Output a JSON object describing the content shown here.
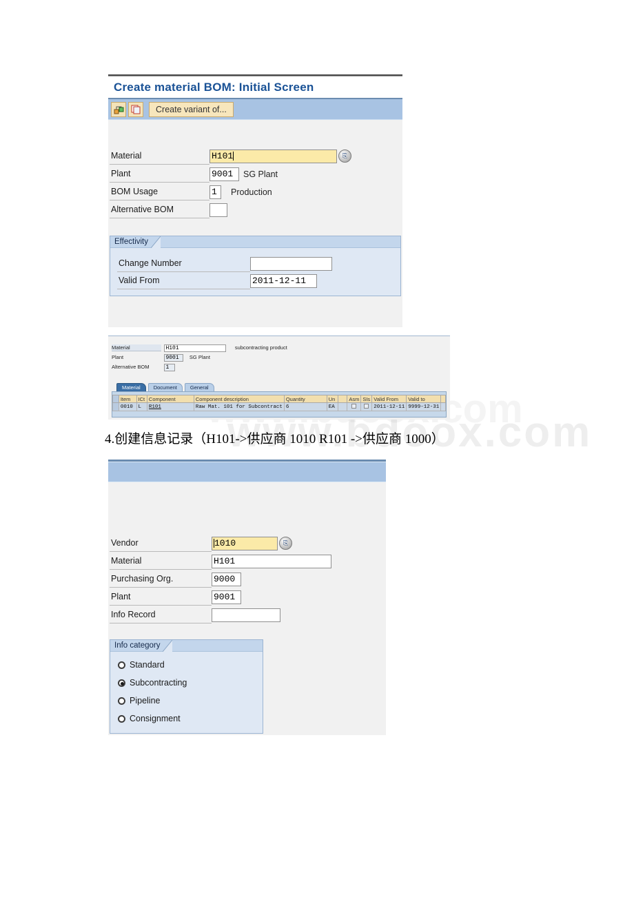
{
  "bom_screen": {
    "title": "Create material BOM: Initial Screen",
    "toolbar": {
      "icon1": "bom-copy-icon",
      "icon2": "copy-window-icon",
      "create_variant_label": "Create variant of..."
    },
    "fields": [
      {
        "label": "Material",
        "value": "H101",
        "desc": "",
        "focused": true
      },
      {
        "label": "Plant",
        "value": "9001",
        "desc": "SG Plant",
        "focused": false
      },
      {
        "label": "BOM Usage",
        "value": "1",
        "desc": "Production",
        "focused": false
      },
      {
        "label": "Alternative BOM",
        "value": "",
        "desc": "",
        "focused": false
      }
    ],
    "effectivity": {
      "legend": "Effectivity",
      "rows": [
        {
          "label": "Change Number",
          "value": ""
        },
        {
          "label": "Valid From",
          "value": "2011-12-11"
        }
      ]
    }
  },
  "bom_items_screen": {
    "header_fields": [
      {
        "label": "Material",
        "value": "H101",
        "desc": "subcontracting product"
      },
      {
        "label": "Plant",
        "value": "9001",
        "desc": "SG Plant"
      },
      {
        "label": "Alternative BOM",
        "value": "1",
        "desc": ""
      }
    ],
    "tabs": [
      {
        "label": "Material",
        "selected": true
      },
      {
        "label": "Document",
        "selected": false
      },
      {
        "label": "General",
        "selected": false
      }
    ],
    "table": {
      "columns": [
        "",
        "Item",
        "ICt",
        "Component",
        "Component description",
        "Quantity",
        "Un",
        "",
        "Asm",
        "SIs",
        "Valid From",
        "Valid to",
        ""
      ],
      "rows": [
        {
          "item": "0010",
          "ict": "L",
          "component": "R101",
          "component_description": "Raw Mat. 101 for Subcontract",
          "quantity": "6",
          "unit": "EA",
          "asm": false,
          "sls": false,
          "valid_from": "2011-12-11",
          "valid_to": "9999-12-31"
        }
      ]
    }
  },
  "caption": "4.创建信息记录（H101->供应商 1010 R101 ->供应商 1000）",
  "info_record_screen": {
    "fields": [
      {
        "label": "Vendor",
        "value": "1010",
        "focused": true,
        "wide": false,
        "f4": true
      },
      {
        "label": "Material",
        "value": "H101",
        "focused": false,
        "wide": true,
        "f4": false
      },
      {
        "label": "Purchasing Org.",
        "value": "9000",
        "focused": false,
        "wide": false,
        "f4": false
      },
      {
        "label": "Plant",
        "value": "9001",
        "focused": false,
        "wide": false,
        "f4": false
      },
      {
        "label": "Info Record",
        "value": "",
        "focused": false,
        "wide": false,
        "f4": false
      }
    ],
    "info_category": {
      "legend": "Info category",
      "options": [
        {
          "label": "Standard",
          "selected": false
        },
        {
          "label": "Subcontracting",
          "selected": true
        },
        {
          "label": "Pipeline",
          "selected": false
        },
        {
          "label": "Consignment",
          "selected": false
        }
      ]
    }
  },
  "watermark": {
    "text": "www.bdoox.com"
  },
  "colors": {
    "title_blue": "#1a5296",
    "toolbar_blue": "#a8c3e3",
    "field_focus": "#fbeaa8",
    "group_bg": "#dfe8f4",
    "grid_header": "#f2dfae",
    "grid_row": "#ccd9e8"
  }
}
